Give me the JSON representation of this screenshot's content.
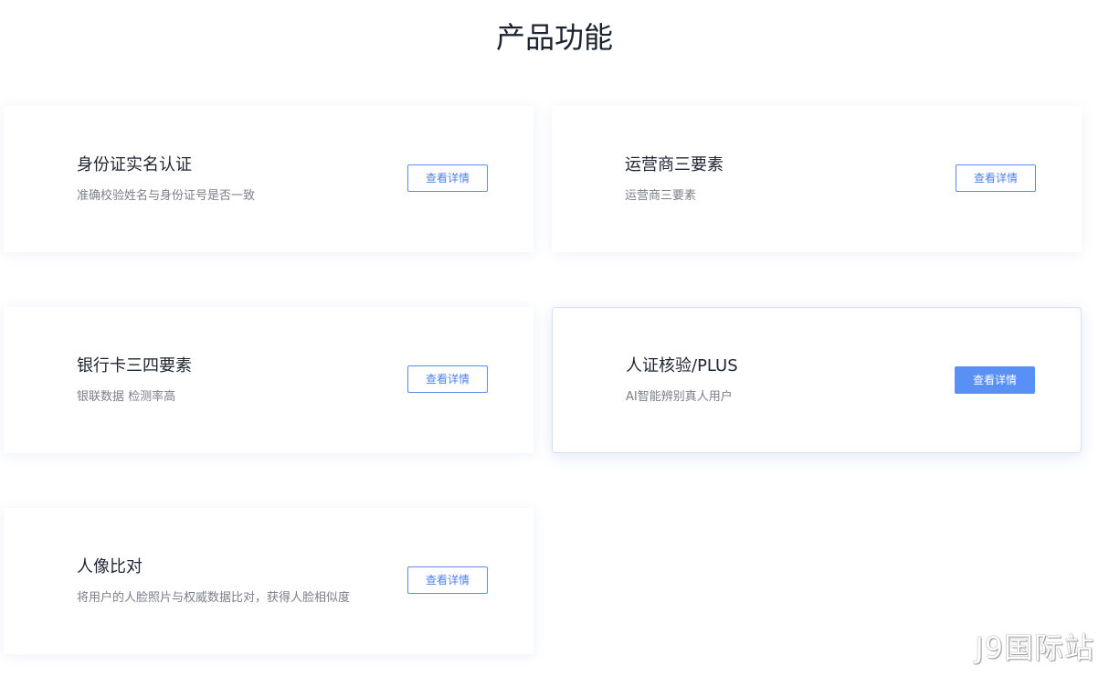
{
  "section": {
    "title": "产品功能"
  },
  "cards": [
    {
      "title": "身份证实名认证",
      "description": "准确校验姓名与身份证号是否一致",
      "button_label": "查看详情"
    },
    {
      "title": "运营商三要素",
      "description": "运营商三要素",
      "button_label": "查看详情"
    },
    {
      "title": "银行卡三四要素",
      "description": "银联数据 检测率高",
      "button_label": "查看详情"
    },
    {
      "title": "人证核验/PLUS",
      "description": "AI智能辨别真人用户",
      "button_label": "查看详情"
    },
    {
      "title": "人像比对",
      "description": "将用户的人脸照片与权威数据比对，获得人脸相似度",
      "button_label": "查看详情"
    }
  ],
  "watermark": "J9国际站",
  "colors": {
    "accent": "#5890f6",
    "button_border": "#5b8df0",
    "text": "#1f2533",
    "muted": "#7a7f8a"
  }
}
